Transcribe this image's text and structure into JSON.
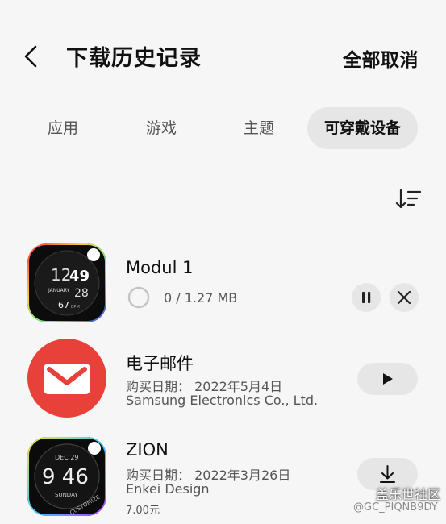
{
  "header": {
    "title": "下载历史记录",
    "cancel_all": "全部取消"
  },
  "tabs": [
    {
      "label": "应用",
      "active": false
    },
    {
      "label": "游戏",
      "active": false
    },
    {
      "label": "主题",
      "active": false
    },
    {
      "label": "可穿戴设备",
      "active": true
    }
  ],
  "items": [
    {
      "name": "Modul 1",
      "progress_text": "0 / 1.27 MB",
      "progress": 0,
      "icon_text": {
        "top": "12",
        "minute": "49",
        "month": "JANUARY",
        "day": "28",
        "bottom": "67",
        "unit": "BPM"
      }
    },
    {
      "name": "电子邮件",
      "purchase_date": "购买日期：  2022年5月4日",
      "publisher": "Samsung Electronics Co., Ltd."
    },
    {
      "name": "ZION",
      "purchase_date": "购买日期：  2022年3月26日",
      "publisher": "Enkei Design",
      "price": "7.00元",
      "icon_text": {
        "date": "DEC 29",
        "time": "9 46",
        "weekday": "SUNDAY",
        "brand": "CUSTOMIZE"
      }
    }
  ],
  "watermark": {
    "line1": "盖乐世社区",
    "line2": "@GC_PIQNB9DY"
  },
  "colors": {
    "background": "#f6f6f6",
    "button_bg": "#e6e6e6",
    "email_red": "#e8413a"
  }
}
